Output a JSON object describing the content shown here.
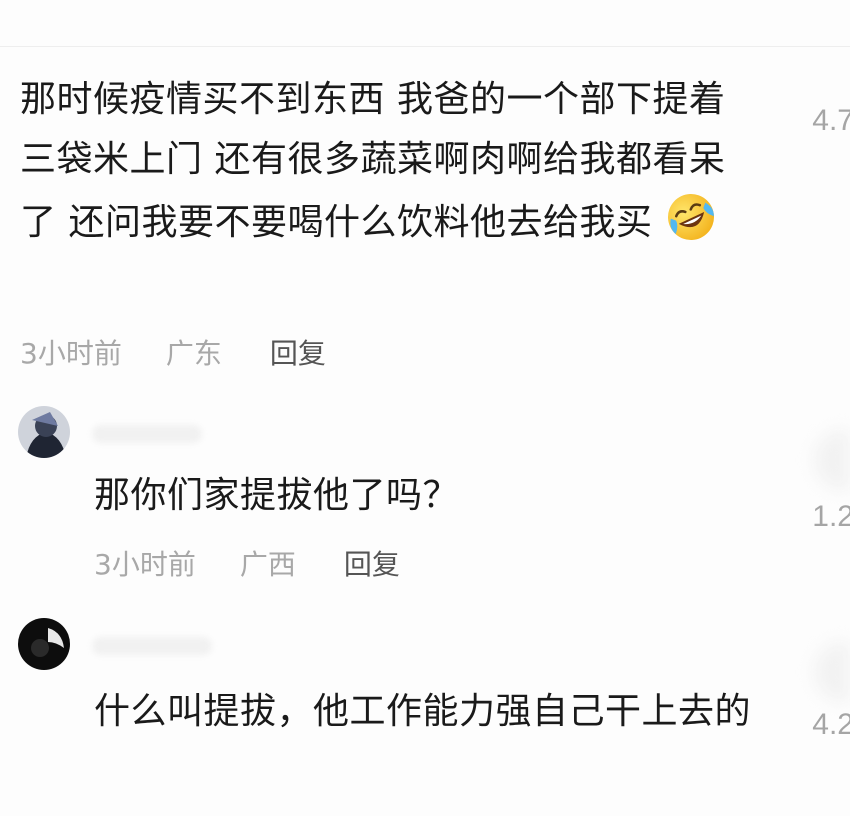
{
  "comments": [
    {
      "text": "那时候疫情买不到东西 我爸的一个部下提着三袋米上门 还有很多蔬菜啊肉啊给我都看呆了 还问我要不要喝什么饮料他去给我买",
      "emoji": "laughing-crying-emoji",
      "time": "3小时前",
      "location": "广东",
      "reply_label": "回复",
      "likes": "4.7"
    },
    {
      "text": "那你们家提拔他了吗？",
      "time": "3小时前",
      "location": "广西",
      "reply_label": "回复",
      "likes": "1.2"
    },
    {
      "text": "什么叫提拔，他工作能力强自己干上去的",
      "likes": "4.2"
    }
  ]
}
